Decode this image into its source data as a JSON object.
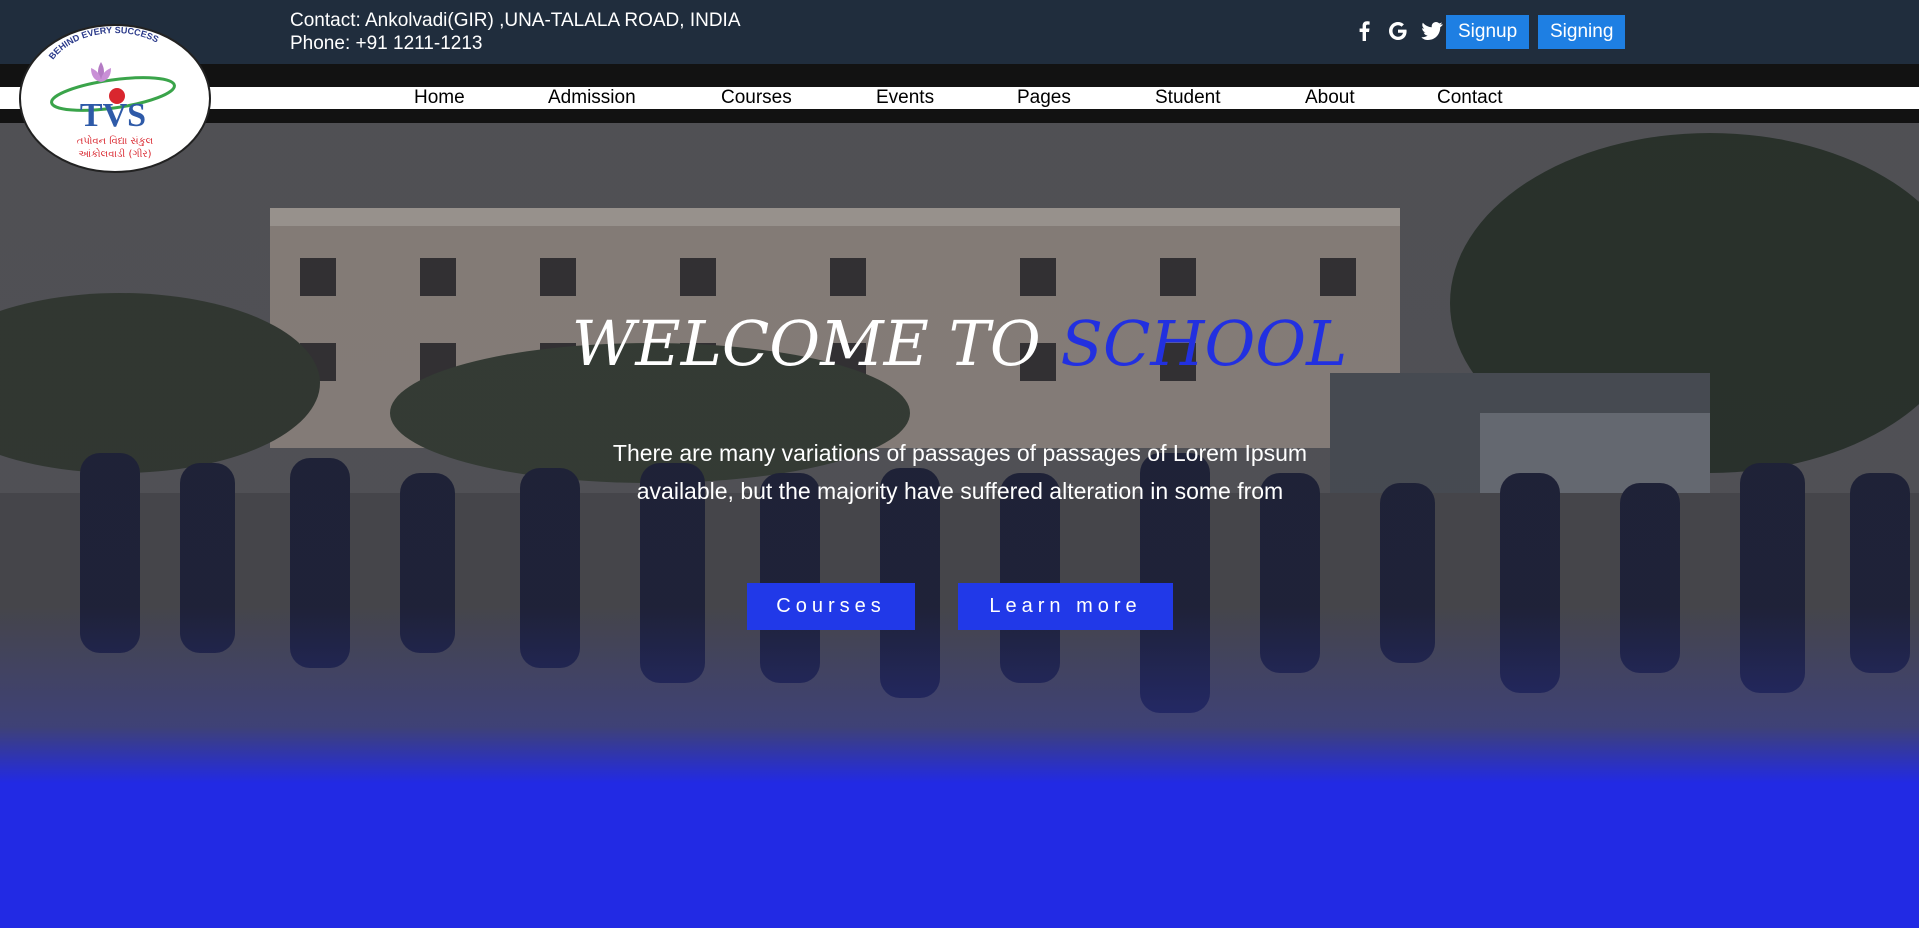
{
  "topbar": {
    "contact_line": "Contact: Ankolvadi(GIR) ,UNA-TALALA ROAD, INDIA",
    "phone_line": "Phone: +91 1211-1213",
    "signup_label": "Signup",
    "signing_label": "Signing",
    "social_icons": [
      "facebook-icon",
      "google-icon",
      "twitter-icon"
    ]
  },
  "logo": {
    "arc_text": "BEHIND EVERY SUCCESS",
    "initials": "TVS",
    "gujarati_line1": "તપોવન વિદ્યા સંકુલ",
    "gujarati_line2": "આંકોલવાડી (ગીર)"
  },
  "nav": {
    "items": [
      "Home",
      "Admission",
      "Courses",
      "Events",
      "Pages",
      "Student",
      "About",
      "Contact"
    ]
  },
  "hero": {
    "title_white": "WELCOME TO ",
    "title_accent": "SCHOOL",
    "description": "There are many variations of passages of passages of Lorem Ipsum available, but the majority have suffered alteration in some from",
    "courses_button": "Courses",
    "learn_more_button": "Learn more"
  },
  "colors": {
    "topbar_bg": "#202d3d",
    "auth_button": "#1e7fe3",
    "accent_blue": "#2230e0",
    "hero_button": "#2139e8"
  }
}
